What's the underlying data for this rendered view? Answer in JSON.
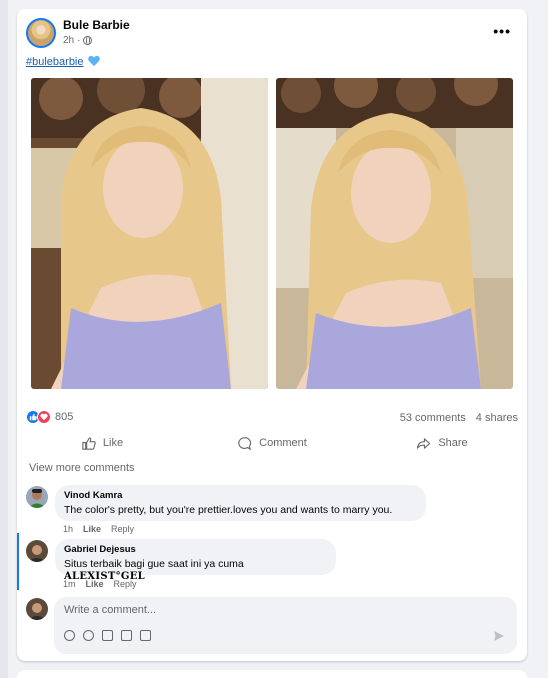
{
  "post": {
    "author": "Bule Barbie",
    "time": "2h",
    "separator": "·",
    "menu_icon": "more-options-icon",
    "hashtag": "#bulebarbie",
    "heart_icon": "blue-heart-icon"
  },
  "reactions": {
    "count": "805",
    "comments": "53 comments",
    "shares": "4 shares"
  },
  "actions": {
    "like": "Like",
    "comment": "Comment",
    "share": "Share"
  },
  "comments_section": {
    "view_more": "View more comments",
    "items": [
      {
        "name": "Vinod Kamra",
        "text": "The color's pretty, but you're prettier.loves you and wants to marry you.",
        "time": "1h",
        "like": "Like",
        "reply": "Reply"
      },
      {
        "name": "Gabriel Dejesus",
        "text_prefix": "Situs terbaik bagi gue saat ini ya cuma ",
        "text_styled": "ALEXIST°GEL",
        "time": "1m",
        "like": "Like",
        "reply": "Reply"
      }
    ]
  },
  "composer": {
    "placeholder": "Write a comment...",
    "icons": [
      "avatar-sticker-icon",
      "emoji-icon",
      "camera-icon",
      "gif-icon",
      "sticker-icon"
    ],
    "send_icon": "send-icon"
  },
  "colors": {
    "accent": "#1877f2",
    "love": "#f33e58",
    "muted": "#65676b",
    "bubble": "#f0f2f5"
  }
}
